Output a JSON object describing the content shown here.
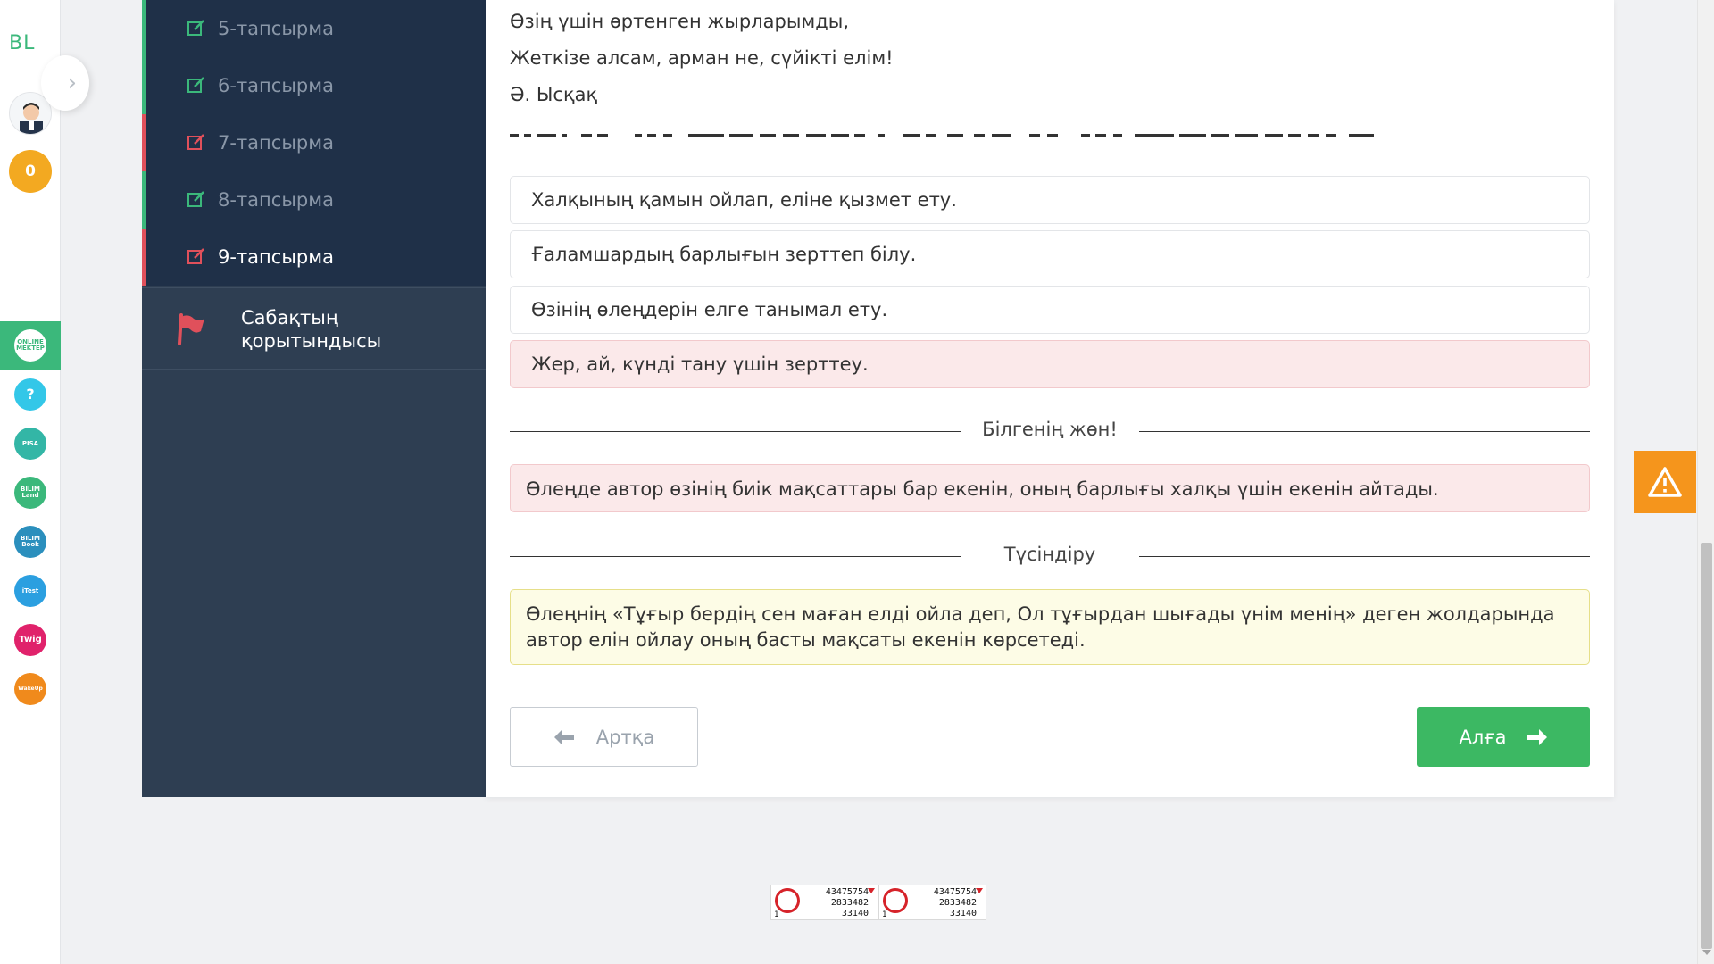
{
  "rail": {
    "logo": "BL",
    "score": "0",
    "apps": [
      {
        "name": "online-mektep",
        "label": "ONLINE MEKTEP",
        "color": "#3bb87b",
        "active": true
      },
      {
        "name": "help",
        "label": "?",
        "color": "#33c7e8",
        "active": false
      },
      {
        "name": "pisa",
        "label": "PISA",
        "color": "#33b6a6",
        "active": false
      },
      {
        "name": "bilimland",
        "label": "BILIM Land",
        "color": "#3bb87b",
        "active": false
      },
      {
        "name": "bilimbook",
        "label": "BILIM Book",
        "color": "#2b8fbd",
        "active": false
      },
      {
        "name": "itest",
        "label": "iTest",
        "color": "#2b9fe0",
        "active": false
      },
      {
        "name": "twig",
        "label": "Twig",
        "color": "#e0226b",
        "active": false
      },
      {
        "name": "wakeup",
        "label": "WakeUp",
        "color": "#f08a1c",
        "active": false
      }
    ]
  },
  "lesson_nav": {
    "items": [
      {
        "label": "5-тапсырма",
        "status": "correct"
      },
      {
        "label": "6-тапсырма",
        "status": "correct"
      },
      {
        "label": "7-тапсырма",
        "status": "wrong"
      },
      {
        "label": "8-тапсырма",
        "status": "correct"
      },
      {
        "label": "9-тапсырма",
        "status": "wrong",
        "current": true
      }
    ],
    "summary_label": "Сабақтың қорытындысы",
    "colors": {
      "correct": "#3bb87b",
      "wrong": "#e0505b"
    }
  },
  "poem": {
    "lines": [
      "Өзің үшін өртенген жырларымды,",
      "Жеткізе алсам, арман не, сүйікті елім!",
      "Ә. Ысқақ"
    ]
  },
  "options": [
    {
      "text": "Халқының қамын ойлап, еліне қызмет ету.",
      "state": "default"
    },
    {
      "text": "Ғаламшардың барлығын зерттеп білу.",
      "state": "default"
    },
    {
      "text": "Өзінің өлеңдерін елге танымал ету.",
      "state": "default"
    },
    {
      "text": "Жер, ай, күнді тану үшін зерттеу.",
      "state": "wrong"
    }
  ],
  "feedback": {
    "header": "Білгенің жөн!",
    "text": "Өлеңде автор өзінің биік мақсаттары бар екенін, оның барлығы халқы үшін екенін айтады."
  },
  "explanation": {
    "header": "Түсіндіру",
    "text": "Өлеңнің «Тұғыр бердің сен маған елді ойла деп, Ол тұғырдан шығады үнім менің» деген жолдарында автор елін ойлау оның басты мақсаты екенін көрсетеді."
  },
  "buttons": {
    "back": "Артқа",
    "next": "Алға"
  },
  "counters": [
    {
      "rows": [
        "43475754",
        "2833482",
        "33140"
      ],
      "label": "1"
    },
    {
      "rows": [
        "43475754",
        "2833482",
        "33140"
      ],
      "label": "1"
    }
  ]
}
